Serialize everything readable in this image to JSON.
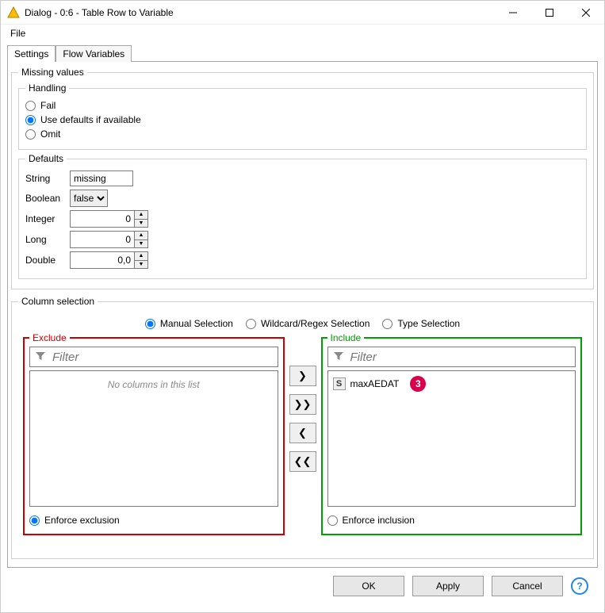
{
  "window": {
    "title": "Dialog - 0:6 - Table Row to Variable"
  },
  "menu": {
    "file": "File"
  },
  "tabs": {
    "settings": "Settings",
    "flowvars": "Flow Variables"
  },
  "missing": {
    "legend": "Missing values",
    "handling": {
      "legend": "Handling",
      "fail": "Fail",
      "use_defaults": "Use defaults if available",
      "omit": "Omit",
      "selected": "use_defaults"
    },
    "defaults": {
      "legend": "Defaults",
      "string_label": "String",
      "string_value": "missing",
      "boolean_label": "Boolean",
      "boolean_value": "false",
      "integer_label": "Integer",
      "integer_value": "0",
      "long_label": "Long",
      "long_value": "0",
      "double_label": "Double",
      "double_value": "0,0"
    }
  },
  "colsel": {
    "legend": "Column selection",
    "mode": {
      "manual": "Manual Selection",
      "regex": "Wildcard/Regex Selection",
      "type": "Type Selection",
      "selected": "manual"
    },
    "exclude": {
      "title": "Exclude",
      "filter_placeholder": "Filter",
      "empty_text": "No columns in this list",
      "enforce": "Enforce exclusion",
      "enforce_selected": true,
      "items": []
    },
    "include": {
      "title": "Include",
      "filter_placeholder": "Filter",
      "enforce": "Enforce inclusion",
      "enforce_selected": false,
      "items": [
        {
          "type": "S",
          "name": "maxAEDAT"
        }
      ]
    },
    "callout": "3"
  },
  "footer": {
    "ok": "OK",
    "apply": "Apply",
    "cancel": "Cancel",
    "help": "?"
  }
}
